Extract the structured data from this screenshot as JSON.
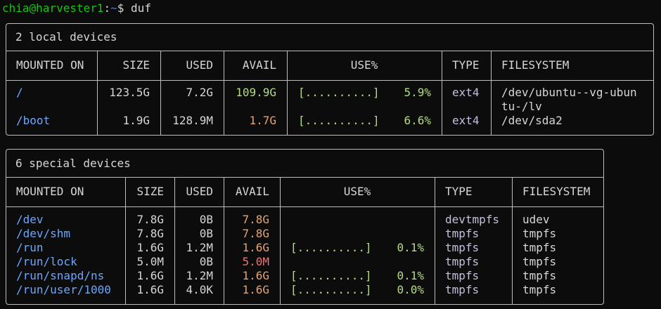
{
  "prompt": {
    "user": "chia@harvester1",
    "sep": ":",
    "path": "~",
    "cmd": "$ duf"
  },
  "colors": {
    "bg": "#0c0c0c",
    "fg": "#d6d6d6",
    "blue": "#6aa7ff",
    "green": "#b5dc84",
    "orange": "#eaa36a",
    "red": "#f07272"
  },
  "local": {
    "title": "2 local devices",
    "headers": [
      "MOUNTED ON",
      "SIZE",
      "USED",
      "AVAIL",
      "USE%",
      "TYPE",
      "FILESYSTEM"
    ],
    "rows": [
      {
        "mount": "/",
        "size": "123.5G",
        "used": "7.2G",
        "avail": "109.9G",
        "bar": "[..........]",
        "pct": "5.9%",
        "type": "ext4",
        "fs1": "/dev/ubuntu--vg-ubun",
        "fs2": "tu-/lv"
      },
      {
        "mount": "/boot",
        "size": "1.9G",
        "used": "128.9M",
        "avail": "1.7G",
        "bar": "[..........]",
        "pct": "6.6%",
        "type": "ext4",
        "fs1": "/dev/sda2",
        "fs2": ""
      }
    ]
  },
  "special": {
    "title": "6 special devices",
    "headers": [
      "MOUNTED ON",
      "SIZE",
      "USED",
      "AVAIL",
      "USE%",
      "TYPE",
      "FILESYSTEM"
    ],
    "rows": [
      {
        "mount": "/dev",
        "size": "7.8G",
        "used": "0B",
        "avail": "7.8G",
        "bar": "",
        "pct": "",
        "type": "devtmpfs",
        "fs": "udev"
      },
      {
        "mount": "/dev/shm",
        "size": "7.8G",
        "used": "0B",
        "avail": "7.8G",
        "bar": "",
        "pct": "",
        "type": "tmpfs",
        "fs": "tmpfs"
      },
      {
        "mount": "/run",
        "size": "1.6G",
        "used": "1.2M",
        "avail": "1.6G",
        "bar": "[..........]",
        "pct": "0.1%",
        "type": "tmpfs",
        "fs": "tmpfs"
      },
      {
        "mount": "/run/lock",
        "size": "5.0M",
        "used": "0B",
        "avail": "5.0M",
        "bar": "",
        "pct": "",
        "type": "tmpfs",
        "fs": "tmpfs"
      },
      {
        "mount": "/run/snapd/ns",
        "size": "1.6G",
        "used": "1.2M",
        "avail": "1.6G",
        "bar": "[..........]",
        "pct": "0.1%",
        "type": "tmpfs",
        "fs": "tmpfs"
      },
      {
        "mount": "/run/user/1000",
        "size": "1.6G",
        "used": "4.0K",
        "avail": "1.6G",
        "bar": "[..........]",
        "pct": "0.0%",
        "type": "tmpfs",
        "fs": "tmpfs"
      }
    ]
  }
}
